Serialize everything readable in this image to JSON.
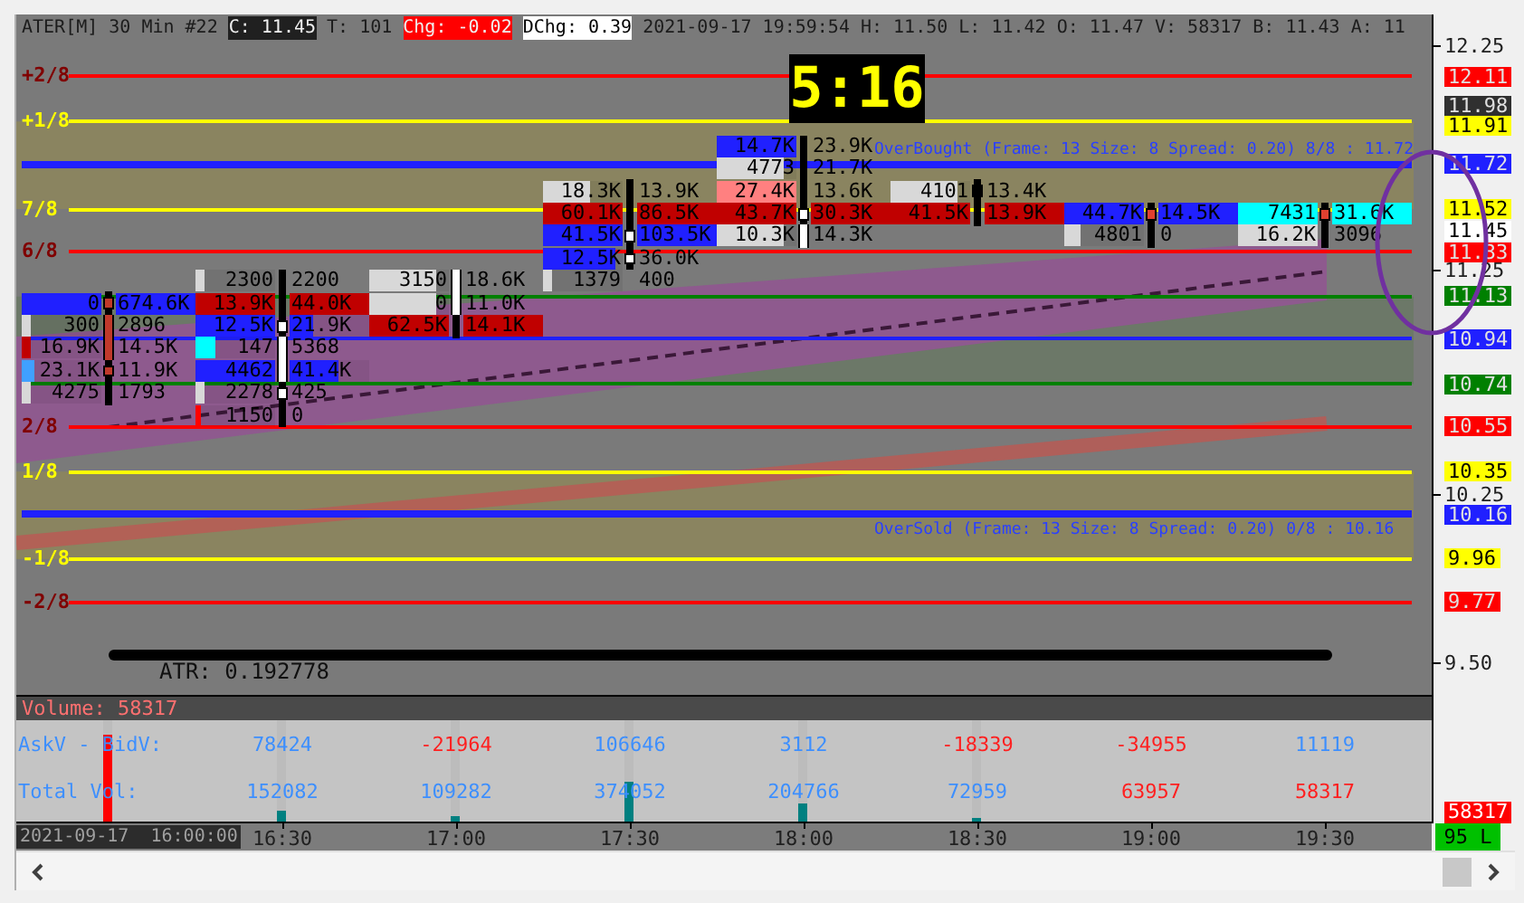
{
  "header": {
    "items": [
      {
        "text": "ATER[M]"
      },
      {
        "text": "30 Min"
      },
      {
        "text": "#22"
      },
      {
        "text": "C: 11.45",
        "color": "#202020"
      },
      {
        "text": "T: 101"
      },
      {
        "text": "Chg: -0.02",
        "color": "#ff0000"
      },
      {
        "text": "DChg: 0.39",
        "color": "#ffffff"
      },
      {
        "text": "2021-09-17 19:59:54"
      },
      {
        "text": "H: 11.50"
      },
      {
        "text": "L: 11.42"
      },
      {
        "text": "O: 11.47"
      },
      {
        "text": "V: 58317"
      },
      {
        "text": "B: 11.43"
      },
      {
        "text": "A: 11"
      }
    ]
  },
  "timer": "5:16",
  "chart": {
    "levels": [
      {
        "label": "+2/8",
        "value": "12.11",
        "color": "#ff0000",
        "kind": "minor"
      },
      {
        "label": "+1/8",
        "value": "11.91",
        "color": "#ffff00",
        "kind": "minor"
      },
      {
        "value": "11.72",
        "color": "#2020ff",
        "kind": "major"
      },
      {
        "label": "7/8",
        "value": "11.52",
        "color": "#ffff00",
        "kind": "minor"
      },
      {
        "label": "6/8",
        "value": "11.33",
        "color": "#ff0000",
        "kind": "minor"
      },
      {
        "value": "11.13",
        "color": "#008000",
        "kind": "minor"
      },
      {
        "value": "10.94",
        "color": "#2020ff",
        "kind": "minor"
      },
      {
        "value": "10.74",
        "color": "#008000",
        "kind": "minor"
      },
      {
        "label": "2/8",
        "value": "10.55",
        "color": "#ff0000",
        "kind": "minor"
      },
      {
        "label": "1/8",
        "value": "10.35",
        "color": "#ffff00",
        "kind": "minor"
      },
      {
        "value": "10.16",
        "color": "#2020ff",
        "kind": "major"
      },
      {
        "label": "-1/8",
        "value": "9.96",
        "color": "#ffff00",
        "kind": "minor"
      },
      {
        "label": "-2/8",
        "value": "9.77",
        "color": "#ff0000",
        "kind": "minor"
      }
    ],
    "overbought_label": "OverBought (Frame: 13 Size: 8 Spread: 0.20) 8/8 : 11.72",
    "oversold_label": "OverSold (Frame: 13 Size: 8 Spread: 0.20) 0/8 : 10.16",
    "candles": [
      {
        "color": "#c0392b",
        "rows": [
          null,
          null,
          null,
          null,
          null,
          null,
          null,
          {
            "body": true,
            "wick": true,
            "left": {
              "text": "0",
              "color": "#2020ff"
            },
            "right": {
              "text": "674.6K",
              "color": "#2020ff"
            }
          },
          {
            "body": true,
            "wick": false,
            "left": {
              "text": "300",
              "color": "#d8d8d8",
              "level": 0.12
            },
            "right": {
              "text": "2896"
            }
          },
          {
            "body": true,
            "wick": false,
            "left": {
              "text": "16.9K",
              "color": "#c00000",
              "level": 0.12
            },
            "right": {
              "text": "14.5K"
            }
          },
          {
            "body": true,
            "wick": true,
            "left": {
              "text": "23.1K",
              "color": "#40a0ff",
              "level": 0.15
            },
            "right": {
              "text": "11.9K"
            }
          },
          {
            "body": false,
            "wick": true,
            "left": {
              "text": "4275",
              "color": "#d8d8d8",
              "level": 0.12
            },
            "right": {
              "text": "1793"
            }
          },
          null
        ]
      },
      {
        "color": "#ffffff",
        "rows": [
          null,
          null,
          null,
          null,
          null,
          null,
          {
            "body": false,
            "wick": true,
            "left": {
              "text": "2300",
              "color": "#d8d8d8",
              "level": 0.12
            },
            "right": {
              "text": "2200"
            }
          },
          {
            "body": false,
            "wick": true,
            "left": {
              "text": "13.9K",
              "color": "#c00000"
            },
            "right": {
              "text": "44.0K",
              "color": "#c00000"
            }
          },
          {
            "body": true,
            "wick": true,
            "left": {
              "text": "12.5K",
              "color": "#2020ff"
            },
            "right": {
              "text": "21.9K",
              "color": "#2020ff",
              "level": 0.3
            }
          },
          {
            "body": true,
            "wick": false,
            "left": {
              "text": "147",
              "color": "#00ffff",
              "level": 0.25
            },
            "right": {
              "text": "5368"
            }
          },
          {
            "body": true,
            "wick": false,
            "left": {
              "text": "4462",
              "color": "#2020ff"
            },
            "right": {
              "text": "41.4K",
              "color": "#2020ff",
              "level": 0.62
            }
          },
          {
            "body": true,
            "wick": true,
            "left": {
              "text": "2278",
              "color": "#d8d8d8",
              "level": 0.12
            },
            "right": {
              "text": "425"
            }
          },
          {
            "body": false,
            "wick": true,
            "left": {
              "text": "1150",
              "color": "#ff0000",
              "level": 0.06
            },
            "right": {
              "text": "0"
            }
          }
        ]
      },
      {
        "color": "#ffffff",
        "rows": [
          null,
          null,
          null,
          null,
          null,
          null,
          {
            "body": true,
            "wick": false,
            "left": {
              "text": "3150",
              "color": "#d8d8d8",
              "level": 0.85
            },
            "right": {
              "text": "18.6K"
            }
          },
          {
            "body": true,
            "wick": false,
            "left": {
              "text": "0",
              "color": "#d8d8d8",
              "level": 0.85
            },
            "right": {
              "text": "11.0K"
            }
          },
          {
            "body": false,
            "wick": true,
            "left": {
              "text": "62.5K",
              "color": "#c00000"
            },
            "right": {
              "text": "14.1K",
              "color": "#c00000"
            }
          },
          null,
          null,
          null,
          null
        ]
      },
      {
        "color": "#ffffff",
        "rows": [
          null,
          null,
          {
            "body": false,
            "wick": true,
            "left": {
              "text": "18.3K",
              "color": "#d8d8d8",
              "level": 0.6
            },
            "right": {
              "text": "13.9K"
            }
          },
          {
            "body": false,
            "wick": true,
            "left": {
              "text": "60.1K",
              "color": "#c00000"
            },
            "right": {
              "text": "86.5K",
              "color": "#c00000"
            }
          },
          {
            "body": true,
            "wick": true,
            "left": {
              "text": "41.5K",
              "color": "#2020ff"
            },
            "right": {
              "text": "103.5K",
              "color": "#2020ff"
            }
          },
          {
            "body": true,
            "wick": true,
            "left": {
              "text": "12.5K",
              "color": "#2020ff",
              "level": 0.9
            },
            "right": {
              "text": "36.0K"
            }
          },
          {
            "left": {
              "text": "1379",
              "color": "#d8d8d8",
              "level": 0.12
            },
            "right": {
              "text": "400"
            }
          },
          null,
          null,
          null,
          null,
          null,
          null
        ]
      },
      {
        "color": "#ffffff",
        "rows": [
          {
            "body": false,
            "wick": true,
            "left": {
              "text": "14.7K",
              "color": "#2020ff"
            },
            "right": {
              "text": "23.9K"
            }
          },
          {
            "body": false,
            "wick": true,
            "left": {
              "text": "4773",
              "color": "#d8d8d8",
              "level": 0.85
            },
            "right": {
              "text": "21.7K"
            }
          },
          {
            "body": false,
            "wick": true,
            "left": {
              "text": "27.4K",
              "color": "#ff8080"
            },
            "right": {
              "text": "13.6K"
            }
          },
          {
            "body": true,
            "wick": true,
            "left": {
              "text": "43.7K",
              "color": "#c00000"
            },
            "right": {
              "text": "30.3K",
              "color": "#c00000"
            }
          },
          {
            "body": true,
            "wick": false,
            "left": {
              "text": "10.3K",
              "color": "#d8d8d8",
              "level": 0.85
            },
            "right": {
              "text": "14.3K"
            }
          },
          null,
          null,
          null,
          null,
          null,
          null,
          null,
          null
        ]
      },
      {
        "color": "#000000",
        "rows": [
          null,
          null,
          {
            "body": true,
            "wick": true,
            "left": {
              "text": "4101",
              "color": "#d8d8d8",
              "level": 0.85
            },
            "right": {
              "text": "13.4K"
            }
          },
          {
            "body": false,
            "wick": true,
            "left": {
              "text": "41.5K",
              "color": "#c00000"
            },
            "right": {
              "text": "13.9K",
              "color": "#c00000"
            }
          },
          null,
          null,
          null,
          null,
          null,
          null,
          null,
          null,
          null
        ]
      },
      {
        "color": "#e04030",
        "rows": [
          null,
          null,
          null,
          {
            "body": true,
            "wick": true,
            "left": {
              "text": "44.7K",
              "color": "#2020ff"
            },
            "right": {
              "text": "14.5K",
              "color": "#2020ff"
            }
          },
          {
            "body": false,
            "wick": true,
            "left": {
              "text": "4801",
              "color": "#d8d8d8",
              "level": 0.2
            },
            "right": {
              "text": "0"
            }
          },
          null,
          null,
          null,
          null,
          null,
          null,
          null,
          null
        ]
      },
      {
        "color": "#e04030",
        "rows": [
          null,
          null,
          null,
          {
            "body": true,
            "wick": true,
            "left": {
              "text": "7431",
              "color": "#00ffff"
            },
            "right": {
              "text": "31.6K",
              "color": "#00ffff"
            }
          },
          {
            "body": false,
            "wick": true,
            "left": {
              "text": "16.2K",
              "color": "#d8d8d8"
            },
            "right": {
              "text": "3096"
            }
          },
          null,
          null,
          null,
          null,
          null,
          null,
          null,
          null
        ]
      }
    ],
    "atr": "ATR: 0.192778"
  },
  "price_axis": {
    "ticks": [
      "12.25",
      "11.25",
      "10.25",
      "9.50"
    ],
    "badges": [
      {
        "text": "11.98",
        "color": "#303030"
      },
      {
        "text": "11.45",
        "color": "#ffffff"
      }
    ],
    "volume_badge": "58317",
    "status_badge": "95 L"
  },
  "volume": {
    "title": "Volume: 58317",
    "rows": [
      {
        "label": "AskV - BidV:",
        "values": [
          {
            "text": "78424",
            "color": "#3d8fff"
          },
          {
            "text": "-21964",
            "color": "#ff2020"
          },
          {
            "text": "106646",
            "color": "#3d8fff"
          },
          {
            "text": "3112",
            "color": "#3d8fff"
          },
          {
            "text": "-18339",
            "color": "#ff2020"
          },
          {
            "text": "-34955",
            "color": "#ff2020"
          },
          {
            "text": "11119",
            "color": "#3d8fff"
          }
        ]
      },
      {
        "label": "Total Vol:",
        "values": [
          {
            "text": "152082",
            "color": "#3d8fff"
          },
          {
            "text": "109282",
            "color": "#3d8fff"
          },
          {
            "text": "374052",
            "color": "#3d8fff"
          },
          {
            "text": "204766",
            "color": "#3d8fff"
          },
          {
            "text": "72959",
            "color": "#3d8fff"
          },
          {
            "text": "63957",
            "color": "#ff2020"
          },
          {
            "text": "58317",
            "color": "#ff2020"
          }
        ]
      }
    ],
    "bars": [
      {
        "level": 0.86,
        "color": "#ff0000"
      },
      {
        "level": 0.11,
        "color": "#008080"
      },
      {
        "level": 0.06,
        "color": "#008080"
      },
      {
        "level": 0.4,
        "color": "#008080"
      },
      {
        "level": 0.18,
        "color": "#008080"
      },
      {
        "level": 0.03,
        "color": "#008080"
      }
    ]
  },
  "time_axis": {
    "cursor_label": "2021-09-17  16:00:00",
    "labels": [
      "16:30",
      "17:00",
      "17:30",
      "18:00",
      "18:30",
      "19:00",
      "19:30"
    ]
  }
}
